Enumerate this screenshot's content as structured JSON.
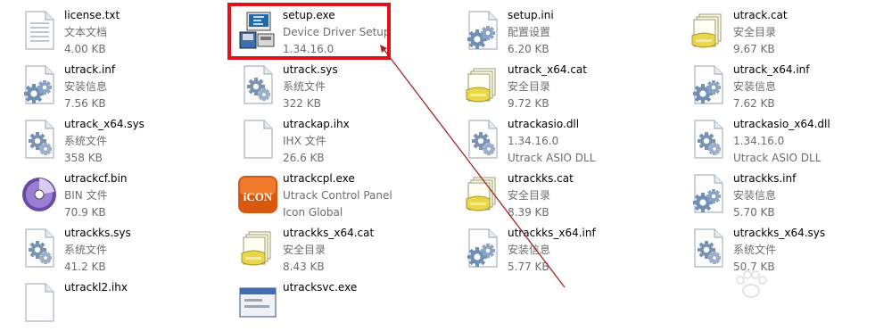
{
  "window": {
    "view": "tiles"
  },
  "files": [
    {
      "icon": "text-file-icon",
      "name": "license.txt",
      "line2": "文本文档",
      "line3": "4.00 KB"
    },
    {
      "icon": "setup-installer-icon",
      "name": "setup.exe",
      "line2": "Device Driver Setup",
      "line3": "1.34.16.0"
    },
    {
      "icon": "config-settings-icon",
      "name": "setup.ini",
      "line2": "配置设置",
      "line3": "6.20 KB"
    },
    {
      "icon": "security-catalog-icon",
      "name": "utrack.cat",
      "line2": "安全目录",
      "line3": "9.67 KB"
    },
    {
      "icon": "setup-info-icon",
      "name": "utrack.inf",
      "line2": "安装信息",
      "line3": "7.56 KB"
    },
    {
      "icon": "system-file-icon",
      "name": "utrack.sys",
      "line2": "系统文件",
      "line3": "322 KB"
    },
    {
      "icon": "security-catalog-icon",
      "name": "utrack_x64.cat",
      "line2": "安全目录",
      "line3": "9.72 KB"
    },
    {
      "icon": "setup-info-icon",
      "name": "utrack_x64.inf",
      "line2": "安装信息",
      "line3": "7.62 KB"
    },
    {
      "icon": "system-file-icon",
      "name": "utrack_x64.sys",
      "line2": "系统文件",
      "line3": "358 KB"
    },
    {
      "icon": "blank-file-icon",
      "name": "utrackap.ihx",
      "line2": "IHX 文件",
      "line3": "26.6 KB"
    },
    {
      "icon": "dll-file-icon",
      "name": "utrackasio.dll",
      "line2": "1.34.16.0",
      "line3": "Utrack ASIO DLL"
    },
    {
      "icon": "dll-file-icon",
      "name": "utrackasio_x64.dll",
      "line2": "1.34.16.0",
      "line3": "Utrack ASIO DLL"
    },
    {
      "icon": "disc-bin-icon",
      "name": "utrackcf.bin",
      "line2": "BIN 文件",
      "line3": "70.9 KB"
    },
    {
      "icon": "icon-global-app-icon",
      "name": "utrackcpl.exe",
      "line2": "Utrack Control Panel",
      "line3": "Icon Global",
      "logo_text": "iCON"
    },
    {
      "icon": "security-catalog-icon",
      "name": "utrackks.cat",
      "line2": "安全目录",
      "line3": "8.39 KB"
    },
    {
      "icon": "setup-info-icon",
      "name": "utrackks.inf",
      "line2": "安装信息",
      "line3": "5.70 KB"
    },
    {
      "icon": "system-file-icon",
      "name": "utrackks.sys",
      "line2": "系统文件",
      "line3": "41.2 KB"
    },
    {
      "icon": "security-catalog-icon",
      "name": "utrackks_x64.cat",
      "line2": "安全目录",
      "line3": "8.43 KB"
    },
    {
      "icon": "setup-info-icon",
      "name": "utrackks_x64.inf",
      "line2": "安装信息",
      "line3": "5.77 KB"
    },
    {
      "icon": "system-file-icon",
      "name": "utrackks_x64.sys",
      "line2": "系统文件",
      "line3": "50.7 KB"
    },
    {
      "icon": "blank-file-icon",
      "name": "utrackl2.ihx",
      "line2": "",
      "line3": ""
    },
    {
      "icon": "window-app-icon",
      "name": "utracksvc.exe",
      "line2": "",
      "line3": ""
    }
  ],
  "annotation": {
    "highlight_color": "#e01218",
    "arrow_color": "#a52424",
    "highlighted_file": "setup.exe"
  },
  "colors": {
    "name_text": "#000000",
    "detail_text": "#6d6d6d",
    "background": "#ffffff"
  }
}
